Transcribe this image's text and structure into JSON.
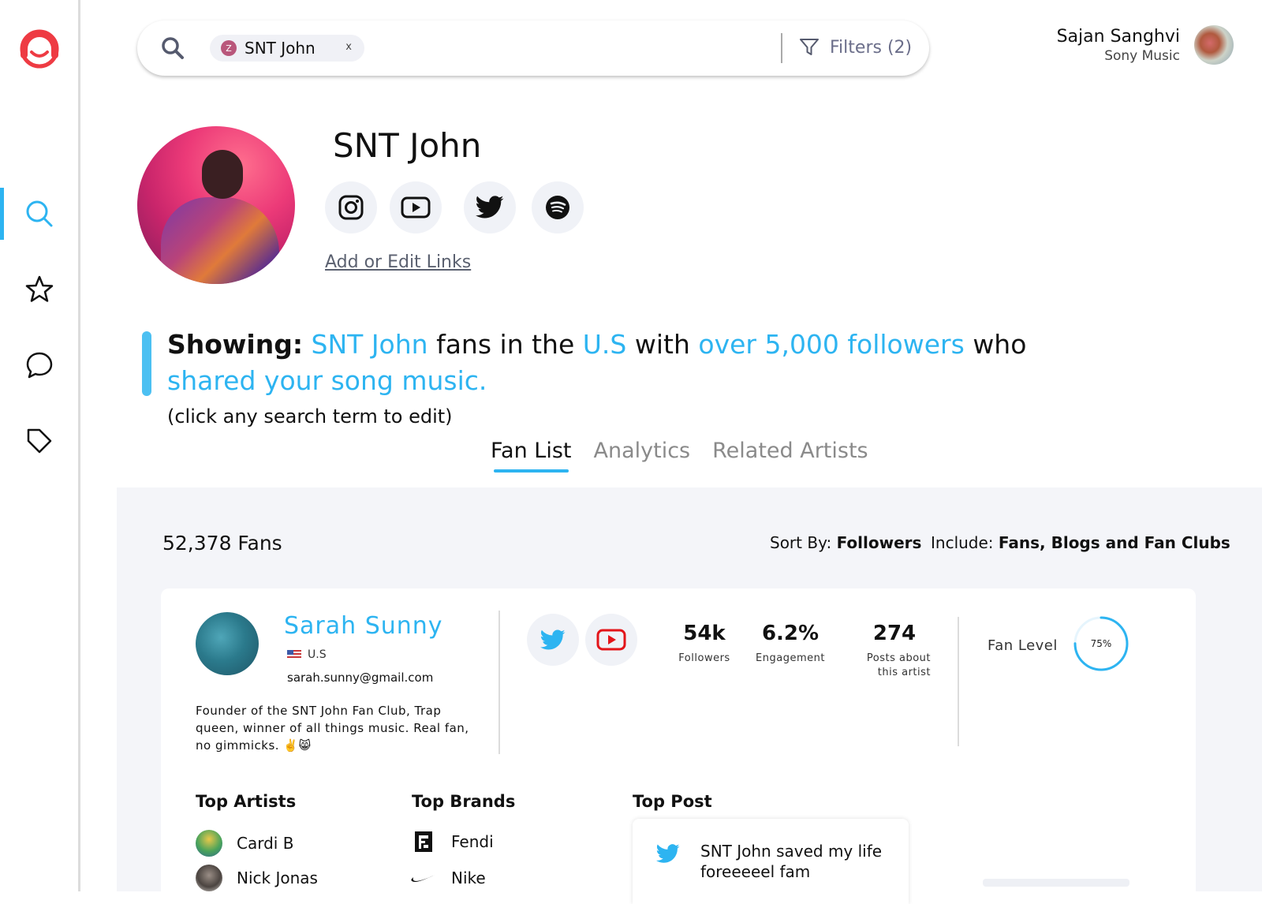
{
  "brand": {
    "logo_icon": "headphones-logo-icon",
    "accent": "#ee3b43",
    "highlight": "#2db4f1"
  },
  "sidebar": {
    "items": [
      {
        "icon": "search-icon",
        "active": true
      },
      {
        "icon": "star-icon",
        "active": false
      },
      {
        "icon": "chat-bubble-icon",
        "active": false
      },
      {
        "icon": "tag-icon",
        "active": false
      }
    ]
  },
  "search": {
    "chip_initial": "Z",
    "chip_label": "SNT John",
    "chip_close": "x",
    "filters_label": "Filters (2)"
  },
  "user": {
    "name": "Sajan Sanghvi",
    "org": "Sony Music"
  },
  "artist": {
    "name": "SNT John",
    "socials": [
      "instagram-icon",
      "youtube-icon",
      "twitter-icon",
      "spotify-icon"
    ],
    "edit_links": "Add or Edit Links"
  },
  "showing": {
    "lead": "Showing:",
    "term_artist": "SNT John",
    "text_1": "fans in the",
    "term_location": "U.S",
    "text_2": "with",
    "term_followers": "over 5,000 followers",
    "text_3": "who",
    "term_action": "shared your song music.",
    "hint": "(click any search term to edit)"
  },
  "tabs": [
    {
      "label": "Fan List",
      "active": true
    },
    {
      "label": "Analytics",
      "active": false
    },
    {
      "label": "Related Artists",
      "active": false
    }
  ],
  "fans": {
    "count": "52,378 Fans",
    "sort_label": "Sort By:",
    "sort_value": "Followers",
    "include_label": "Include:",
    "include_value": "Fans, Blogs and Fan Clubs"
  },
  "fan_card": {
    "name": "Sarah Sunny",
    "location": "U.S",
    "email": "sarah.sunny@gmail.com",
    "bio": "Founder of the SNT John Fan Club, Trap queen, winner of all things music. Real fan, no gimmicks. ✌️😸",
    "socials": [
      "twitter-icon",
      "youtube-icon"
    ],
    "stats": [
      {
        "value": "54k",
        "label": "Followers"
      },
      {
        "value": "6.2%",
        "label": "Engagement"
      },
      {
        "value": "274",
        "label": "Posts about this artist"
      }
    ],
    "fan_level_label": "Fan Level",
    "fan_level_value": "75%",
    "fan_level_fraction": 0.75,
    "top_artists_title": "Top Artists",
    "top_artists": [
      "Cardi B",
      "Nick Jonas"
    ],
    "top_brands_title": "Top Brands",
    "top_brands": [
      "Fendi",
      "Nike"
    ],
    "top_post_title": "Top Post",
    "top_post_text": "SNT John saved my life foreeeeel fam"
  }
}
